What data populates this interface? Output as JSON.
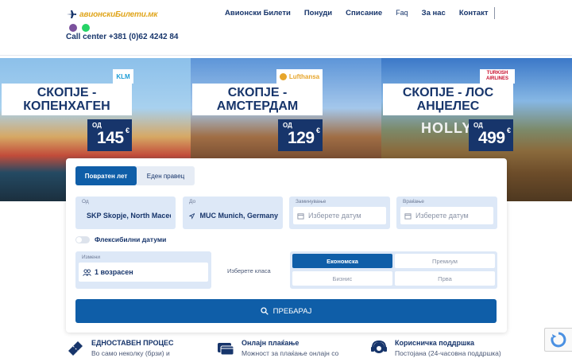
{
  "header": {
    "logo_text": "авионскиБилети.мк",
    "call_center": "Call center +381 (0)62 4242 84",
    "nav": [
      "Авионски Билети",
      "Понуди",
      "Списание",
      "Faq",
      "За нас",
      "Контакт"
    ]
  },
  "offers": [
    {
      "title_line1": "СКОПЈЕ -",
      "title_line2": "КОПЕНХАГЕН",
      "from": "ОД",
      "price": "145",
      "currency": "€",
      "airline": "KLM"
    },
    {
      "title_line1": "СКОПЈЕ -",
      "title_line2": "АМСТЕРДАМ",
      "from": "ОД",
      "price": "129",
      "currency": "€",
      "airline": "Lufthansa"
    },
    {
      "title_line1": "СКОПЈЕ - ЛОС",
      "title_line2": "АНЏЕЛЕС",
      "from": "ОД",
      "price": "499",
      "currency": "€",
      "airline_line1": "TURKISH",
      "airline_line2": "AIRLINES",
      "sign": "HOLLY"
    }
  ],
  "search": {
    "tabs": [
      "Повратен лет",
      "Еден правец"
    ],
    "from_label": "Од",
    "from_value": "SKP Skopje, North Macedonia",
    "to_label": "До",
    "to_value": "MUC Munich, Germany",
    "depart_label": "Заминување",
    "depart_placeholder": "Изберете датум",
    "return_label": "Враќање",
    "return_placeholder": "Изберете датум",
    "flexible_label": "Флексибилни датуми",
    "pax_label": "Измени",
    "pax_value": "1 возрасен",
    "class_label": "Изберете класа",
    "classes": [
      "Економска",
      "Премиум",
      "Бизнис",
      "Прва"
    ],
    "search_button": "ПРЕБАРАЈ"
  },
  "features": [
    {
      "title": "ЕДНОСТАВЕН ПРОЦЕС",
      "desc": "Во само неколку (брзи) и"
    },
    {
      "title": "Онлајн плаќање",
      "desc": "Можност за плаќање онлајн со"
    },
    {
      "title": "Корисничка поддршка",
      "desc": "Постојана (24-часовна поддршка)"
    }
  ],
  "colors": {
    "primary": "#0f5ea8",
    "navy": "#17356b",
    "field_bg": "#dde8f7",
    "logo_accent": "#e0a51b"
  }
}
